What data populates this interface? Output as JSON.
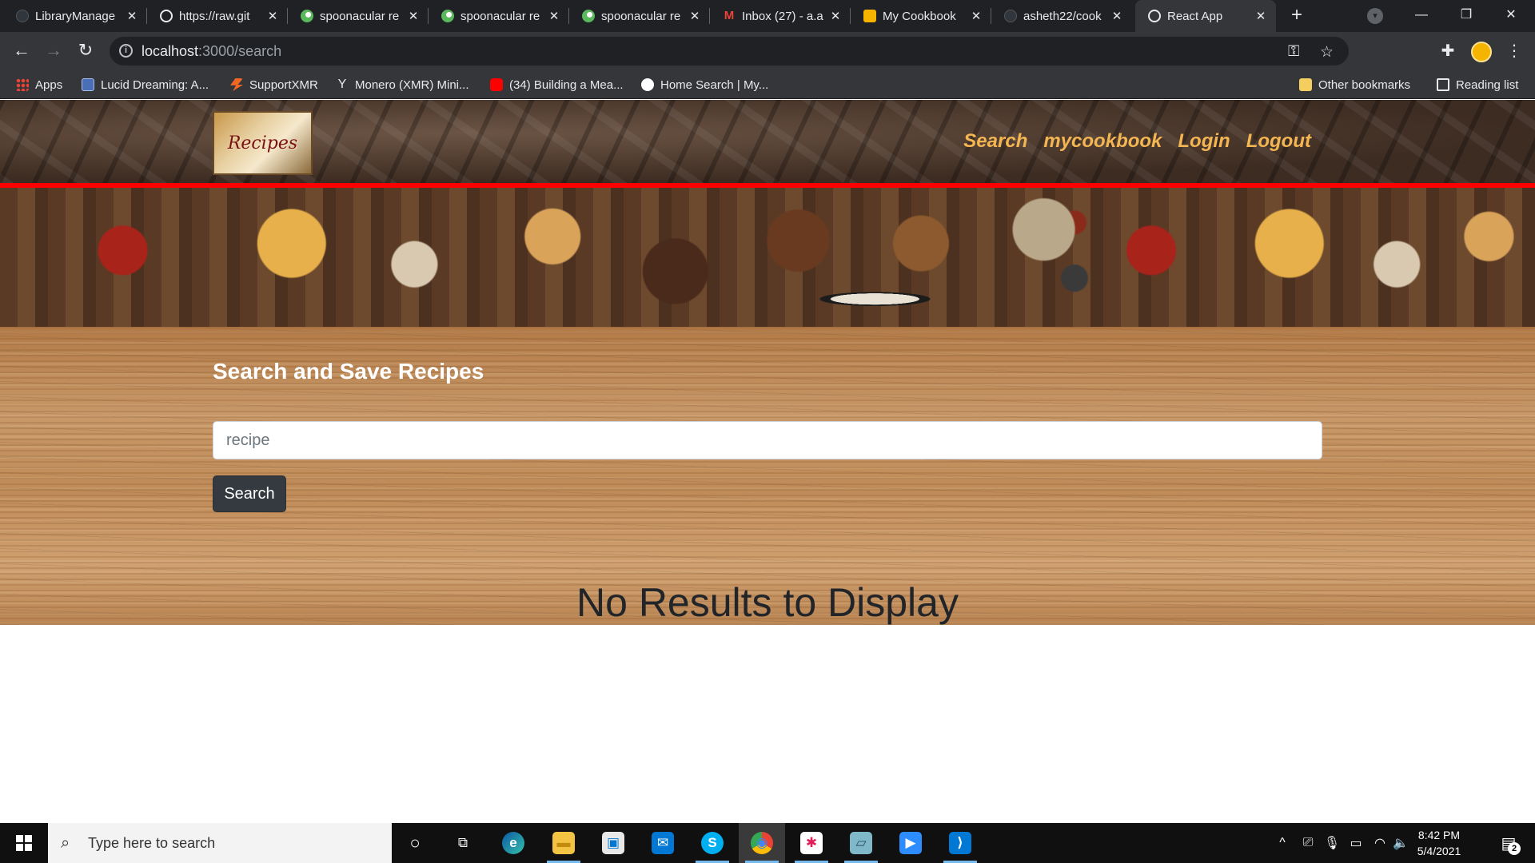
{
  "browser": {
    "tabs": [
      {
        "title": "LibraryManage",
        "icon": "github-icon"
      },
      {
        "title": "https://raw.git",
        "icon": "globe-icon"
      },
      {
        "title": "spoonacular re",
        "icon": "spoonacular-icon"
      },
      {
        "title": "spoonacular re",
        "icon": "spoonacular-icon"
      },
      {
        "title": "spoonacular re",
        "icon": "spoonacular-icon"
      },
      {
        "title": "Inbox (27) - a.a",
        "icon": "gmail-icon"
      },
      {
        "title": "My Cookbook",
        "icon": "slides-icon"
      },
      {
        "title": "asheth22/cook",
        "icon": "github-icon"
      },
      {
        "title": "React App",
        "icon": "globe-icon",
        "active": true
      }
    ],
    "tab_close_glyph": "✕",
    "new_tab_glyph": "+",
    "window_controls": {
      "minimize": "—",
      "restore": "❐",
      "close": "✕"
    },
    "nav": {
      "back": "←",
      "forward": "→",
      "reload": "↻"
    },
    "address": {
      "host": "localhost",
      "path": ":3000/search"
    },
    "address_icons": {
      "key": "⚿",
      "star": "☆"
    },
    "toolbar_icons": {
      "extensions": "✚",
      "menu": "⋮"
    },
    "bookmarks": [
      {
        "label": "Apps",
        "icon": "apps-icon"
      },
      {
        "label": "Lucid Dreaming: A...",
        "icon": "grid-icon"
      },
      {
        "label": "SupportXMR",
        "icon": "xmr-icon"
      },
      {
        "label": "Monero (XMR) Mini...",
        "icon": "monero-icon"
      },
      {
        "label": "(34) Building a Mea...",
        "icon": "youtube-icon"
      },
      {
        "label": "Home Search | My...",
        "icon": "home-icon"
      }
    ],
    "other_bookmarks": "Other bookmarks",
    "reading_list": "Reading list"
  },
  "site": {
    "logo_text": "Recipes",
    "nav": [
      "Search",
      "mycookbook",
      "Login",
      "Logout"
    ],
    "heading": "Search and Save Recipes",
    "search_placeholder": "recipe",
    "search_value": "",
    "search_button": "Search",
    "empty_message": "No Results to Display"
  },
  "taskbar": {
    "search_placeholder": "Type here to search",
    "apps": [
      {
        "name": "cortana",
        "glyph": "○"
      },
      {
        "name": "task-view",
        "glyph": "⧉"
      },
      {
        "name": "edge",
        "glyph": "e"
      },
      {
        "name": "file-explorer",
        "glyph": "▬"
      },
      {
        "name": "store",
        "glyph": "▣"
      },
      {
        "name": "mail",
        "glyph": "✉"
      },
      {
        "name": "skype",
        "glyph": "S"
      },
      {
        "name": "chrome",
        "glyph": "◉"
      },
      {
        "name": "slack",
        "glyph": "✱"
      },
      {
        "name": "notes",
        "glyph": "▱"
      },
      {
        "name": "zoom",
        "glyph": "▶"
      },
      {
        "name": "vscode",
        "glyph": "⟩"
      }
    ],
    "tray_icons": [
      "^",
      "⎚",
      "🎙",
      "▭",
      "◠",
      "🔈"
    ],
    "time": "8:42 PM",
    "date": "5/4/2021",
    "notification_count": "2"
  },
  "colors": {
    "nav_link": "#f3b653",
    "accent_line": "#ff0000",
    "button_bg": "#343a40",
    "taskbar_bg": "#101010",
    "chrome_bg": "#202124"
  }
}
